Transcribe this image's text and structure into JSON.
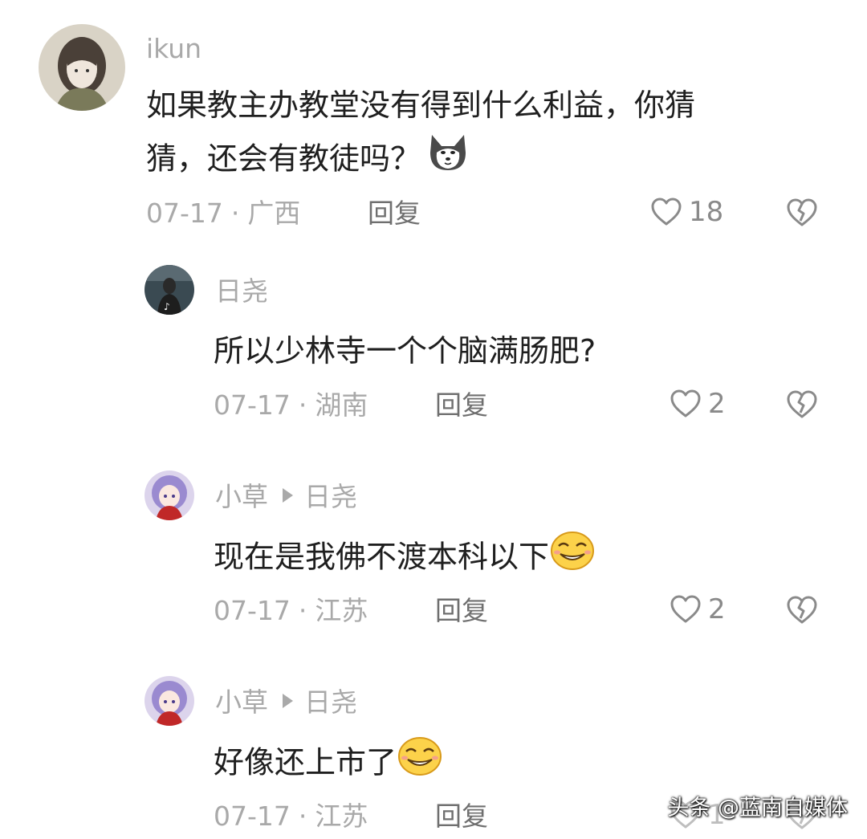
{
  "comments": [
    {
      "username": "ikun",
      "reply_to": "",
      "text_line1": "如果教主办教堂没有得到什么利益，你猜",
      "text_line2": "猜，还会有教徒吗？",
      "emoji_icon": "husky-dog-emoji",
      "date": "07-17",
      "separator": "·",
      "location": "广西",
      "reply_label": "回复",
      "likes": "18"
    },
    {
      "username": "日尧",
      "reply_to": "",
      "text_line1": "所以少林寺一个个脑满肠肥?",
      "date": "07-17",
      "separator": "·",
      "location": "湖南",
      "reply_label": "回复",
      "likes": "2"
    },
    {
      "username": "小草",
      "reply_to": "日尧",
      "text_line1": "现在是我佛不渡本科以下",
      "emoji_icon": "smirk-laugh-emoji",
      "date": "07-17",
      "separator": "·",
      "location": "江苏",
      "reply_label": "回复",
      "likes": "2"
    },
    {
      "username": "小草",
      "reply_to": "日尧",
      "text_line1": "好像还上市了",
      "emoji_icon": "smirk-laugh-emoji",
      "date": "07-17",
      "separator": "·",
      "location": "江苏",
      "reply_label": "回复",
      "likes": "1"
    }
  ],
  "watermark": "头条 @蓝南自媒体",
  "colors": {
    "text": "#1f1f1f",
    "muted": "#a9a9a9",
    "icon": "#8a8a8a"
  }
}
